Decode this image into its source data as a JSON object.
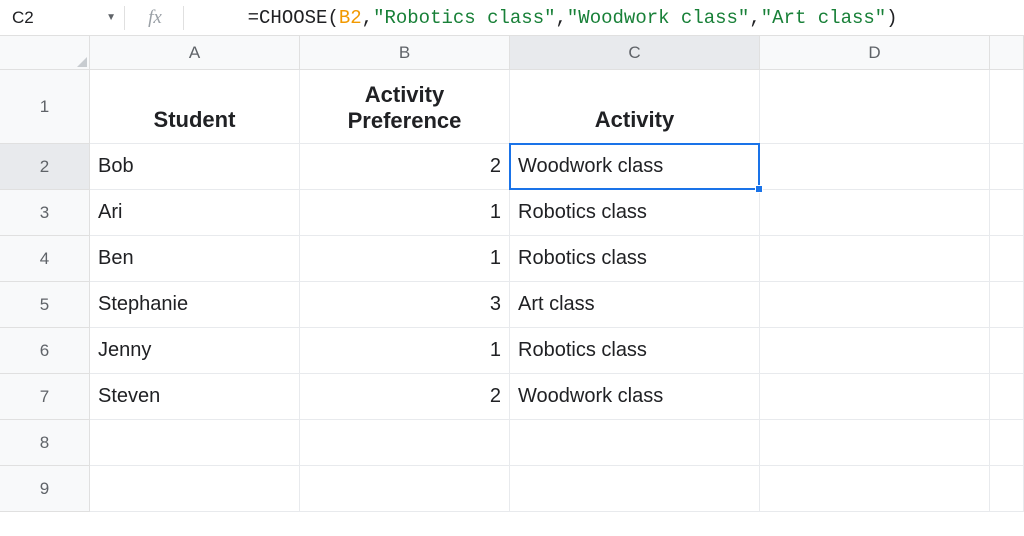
{
  "name_box": "C2",
  "fx_label": "fx",
  "formula": {
    "eq": "=",
    "fn": "CHOOSE",
    "open": "(",
    "ref": "B2",
    "c1": ",",
    "a1": "\"Robotics class\"",
    "c2": ",",
    "a2": "\"Woodwork class\"",
    "c3": ",",
    "a3": "\"Art class\"",
    "close": ")"
  },
  "columns": [
    "A",
    "B",
    "C",
    "D",
    ""
  ],
  "row_numbers": [
    "1",
    "2",
    "3",
    "4",
    "5",
    "6",
    "7",
    "8",
    "9"
  ],
  "headers": {
    "A": "Student",
    "B": "Activity\nPreference",
    "C": "Activity"
  },
  "rows": [
    {
      "A": "Bob",
      "B": "2",
      "C": "Woodwork class"
    },
    {
      "A": "Ari",
      "B": "1",
      "C": "Robotics class"
    },
    {
      "A": "Ben",
      "B": "1",
      "C": "Robotics class"
    },
    {
      "A": "Stephanie",
      "B": "3",
      "C": "Art class"
    },
    {
      "A": "Jenny",
      "B": "1",
      "C": "Robotics class"
    },
    {
      "A": "Steven",
      "B": "2",
      "C": "Woodwork class"
    }
  ],
  "selected": {
    "col": "C",
    "row": "2"
  },
  "chart_data": {
    "type": "table",
    "title": "Student Activity Assignment via CHOOSE",
    "columns": [
      "Student",
      "Activity Preference",
      "Activity"
    ],
    "rows": [
      [
        "Bob",
        2,
        "Woodwork class"
      ],
      [
        "Ari",
        1,
        "Robotics class"
      ],
      [
        "Ben",
        1,
        "Robotics class"
      ],
      [
        "Stephanie",
        3,
        "Art class"
      ],
      [
        "Jenny",
        1,
        "Robotics class"
      ],
      [
        "Steven",
        2,
        "Woodwork class"
      ]
    ]
  }
}
